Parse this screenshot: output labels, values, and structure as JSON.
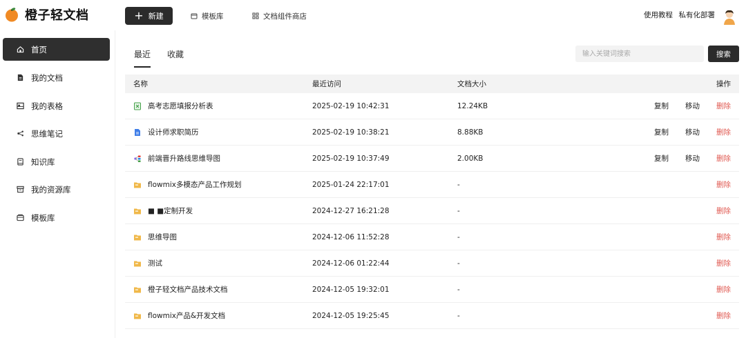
{
  "app": {
    "title": "橙子轻文档",
    "new_button": "新建",
    "top_nav": [
      "模板库",
      "文档组件商店"
    ],
    "top_right": [
      "使用教程",
      "私有化部署"
    ],
    "brand_color": "#f08a24"
  },
  "sidebar": {
    "items": [
      {
        "label": "首页",
        "icon": "home-icon",
        "active": true
      },
      {
        "label": "我的文档",
        "icon": "document-icon",
        "active": false
      },
      {
        "label": "我的表格",
        "icon": "table-icon",
        "active": false
      },
      {
        "label": "思维笔记",
        "icon": "mindmap-icon",
        "active": false
      },
      {
        "label": "知识库",
        "icon": "book-icon",
        "active": false
      },
      {
        "label": "我的资源库",
        "icon": "archive-icon",
        "active": false
      },
      {
        "label": "模板库",
        "icon": "template-icon",
        "active": false
      }
    ]
  },
  "main": {
    "tabs": [
      "最近",
      "收藏"
    ],
    "search": {
      "placeholder": "输入关键词搜索",
      "button": "搜索"
    },
    "table": {
      "headers": [
        "名称",
        "最近访问",
        "文档大小",
        "操作"
      ],
      "rows": [
        {
          "name": "高考志愿填报分析表",
          "date": "2025-02-19 10:42:31",
          "size": "12.24KB",
          "icon": "spreadsheet-icon",
          "ops": [
            "复制",
            "移动",
            "删除"
          ]
        },
        {
          "name": "设计师求职简历",
          "date": "2025-02-19 10:38:21",
          "size": "8.88KB",
          "icon": "doc-file-icon",
          "ops": [
            "复制",
            "移动",
            "删除"
          ]
        },
        {
          "name": "前端晋升路线思维导图",
          "date": "2025-02-19 10:37:49",
          "size": "2.00KB",
          "icon": "mindmap-file-icon",
          "ops": [
            "复制",
            "移动",
            "删除"
          ]
        },
        {
          "name": "flowmix多模态产品工作规划",
          "date": "2025-01-24 22:17:01",
          "size": "-",
          "icon": "folder-icon",
          "ops": [
            "删除"
          ]
        },
        {
          "name": "■ ■定制开发",
          "date": "2024-12-27 16:21:28",
          "size": "-",
          "icon": "folder-icon",
          "ops": [
            "删除"
          ]
        },
        {
          "name": "思维导图",
          "date": "2024-12-06 11:52:28",
          "size": "-",
          "icon": "folder-icon",
          "ops": [
            "删除"
          ]
        },
        {
          "name": "测试",
          "date": "2024-12-06 01:22:44",
          "size": "-",
          "icon": "folder-icon",
          "ops": [
            "删除"
          ]
        },
        {
          "name": "橙子轻文档产品技术文档",
          "date": "2024-12-05 19:32:01",
          "size": "-",
          "icon": "folder-icon",
          "ops": [
            "删除"
          ]
        },
        {
          "name": "flowmix产品&开发文档",
          "date": "2024-12-05 19:25:45",
          "size": "-",
          "icon": "folder-icon",
          "ops": [
            "删除"
          ]
        }
      ]
    }
  }
}
